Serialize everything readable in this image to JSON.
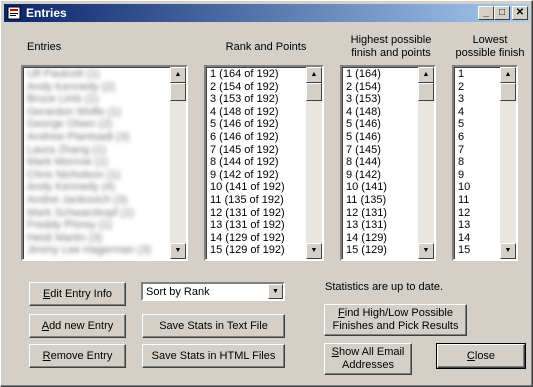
{
  "window": {
    "title": "Entries",
    "minimize": "_",
    "maximize": "□",
    "close": "✕"
  },
  "headers": {
    "entries": "Entries",
    "rank_points": "Rank and Points",
    "highest": "Highest possible finish and points",
    "lowest": "Lowest possible finish"
  },
  "entries_list": [
    "Ulf Paulcott (1)",
    "Andy Kennedy (2)",
    "Bruce Lints (1)",
    "Gerardon Wolfe (1)",
    "George Olsen (2)",
    "Andrew Plantsadt (3)",
    "Laura Zhang (1)",
    "Mark Monroe (1)",
    "Chris Nicholson (1)",
    "Andy Kennedy (4)",
    "Andrei Jankovich (3)",
    "Mark Schwarzkopf (1)",
    "Freddy Phirey (1)",
    "Heidi Martin (3)",
    "Jimmy Lee Hagerman (3)"
  ],
  "rank_points": [
    "1  (164 of 192)",
    "2  (154 of 192)",
    "3  (153 of 192)",
    "4  (148 of 192)",
    "5  (146 of 192)",
    "6  (146 of 192)",
    "7  (145 of 192)",
    "8  (144 of 192)",
    "9  (142 of 192)",
    "10  (141 of 192)",
    "11  (135 of 192)",
    "12  (131 of 192)",
    "13  (131 of 192)",
    "14  (129 of 192)",
    "15  (129 of 192)"
  ],
  "highest": [
    "1  (164)",
    "2  (154)",
    "3  (153)",
    "4  (148)",
    "5  (146)",
    "5  (146)",
    "7  (145)",
    "8  (144)",
    "9  (142)",
    "10  (141)",
    "11  (135)",
    "12  (131)",
    "13  (131)",
    "14  (129)",
    "15  (129)"
  ],
  "lowest": [
    "1",
    "2",
    "3",
    "4",
    "5",
    "6",
    "7",
    "8",
    "9",
    "10",
    "11",
    "12",
    "13",
    "14",
    "15"
  ],
  "buttons": {
    "edit_entry": "Edit Entry Info",
    "add_entry": "Add new Entry",
    "remove_entry": "Remove Entry",
    "save_text": "Save Stats in Text File",
    "save_html": "Save Stats in HTML Files",
    "find_high_low": "Find High/Low Possible Finishes and Pick Results",
    "show_emails": "Show All Email Addresses",
    "close": "Close"
  },
  "sort": {
    "selected": "Sort by Rank"
  },
  "status": "Statistics are up to date."
}
